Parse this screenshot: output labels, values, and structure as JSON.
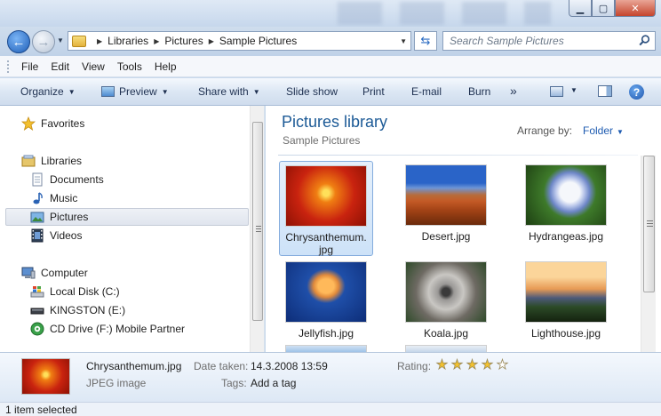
{
  "window": {
    "minimize_glyph": "▁",
    "maximize_glyph": "▢",
    "close_glyph": "✕"
  },
  "address_bar": {
    "back_icon": "back-arrow-icon",
    "forward_icon": "forward-arrow-icon",
    "breadcrumbs": [
      "Libraries",
      "Pictures",
      "Sample Pictures"
    ],
    "refresh_icon": "refresh-icon"
  },
  "search": {
    "placeholder": "Search Sample Pictures"
  },
  "menu": [
    "File",
    "Edit",
    "View",
    "Tools",
    "Help"
  ],
  "toolbar": {
    "organize": "Organize",
    "preview": "Preview",
    "share_with": "Share with",
    "slide_show": "Slide show",
    "print": "Print",
    "email": "E-mail",
    "burn": "Burn",
    "more": "»"
  },
  "nav": {
    "favorites": "Favorites",
    "libraries": "Libraries",
    "documents": "Documents",
    "music": "Music",
    "pictures": "Pictures",
    "videos": "Videos",
    "computer": "Computer",
    "local_disk": "Local Disk (C:)",
    "kingston": "KINGSTON (E:)",
    "cd_drive": "CD Drive (F:) Mobile Partner"
  },
  "content": {
    "title": "Pictures library",
    "subtitle": "Sample Pictures",
    "arrange_label": "Arrange by:",
    "arrange_value": "Folder",
    "files": [
      {
        "name": "Chrysanthemum.",
        "name2": "jpg"
      },
      {
        "name": "Desert.jpg"
      },
      {
        "name": "Hydrangeas.jpg"
      },
      {
        "name": "Jellyfish.jpg"
      },
      {
        "name": "Koala.jpg"
      },
      {
        "name": "Lighthouse.jpg"
      }
    ]
  },
  "details": {
    "file_name": "Chrysanthemum.jpg",
    "file_type": "JPEG image",
    "date_label": "Date taken:",
    "date_value": "14.3.2008 13:59",
    "tags_label": "Tags:",
    "tags_value": "Add a tag",
    "rating_label": "Rating:",
    "rating": 4,
    "rating_max": 5
  },
  "status": {
    "text": "1 item selected"
  },
  "colors": {
    "accent": "#1c5a96",
    "link": "#1c5ab0",
    "star_filled": "#f2c12e"
  }
}
